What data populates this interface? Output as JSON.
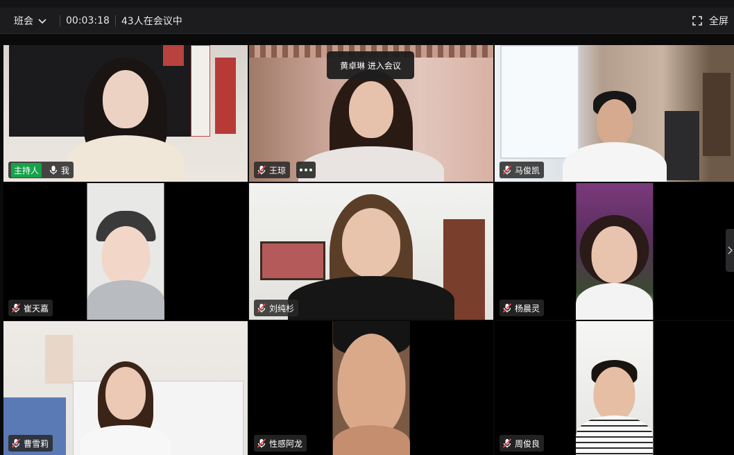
{
  "topbar": {
    "view_label": "班会",
    "elapsed": "00:03:18",
    "participants": "43人在会议中",
    "fullscreen_label": "全屏"
  },
  "toast": "黄卓琳 进入会议",
  "host_badge": "主持人",
  "participants": [
    {
      "name": "我",
      "mic": "on",
      "host": true
    },
    {
      "name": "王琼",
      "mic": "muted"
    },
    {
      "name": "马俊凯",
      "mic": "muted"
    },
    {
      "name": "崔天嘉",
      "mic": "muted"
    },
    {
      "name": "刘纯杉",
      "mic": "muted"
    },
    {
      "name": "杨晨灵",
      "mic": "muted"
    },
    {
      "name": "曹雪莉",
      "mic": "muted"
    },
    {
      "name": "性感阿龙",
      "mic": "muted"
    },
    {
      "name": "周俊良",
      "mic": "muted"
    }
  ],
  "colors": {
    "host_green": "#16a34a",
    "muted_red": "#e5484d"
  }
}
